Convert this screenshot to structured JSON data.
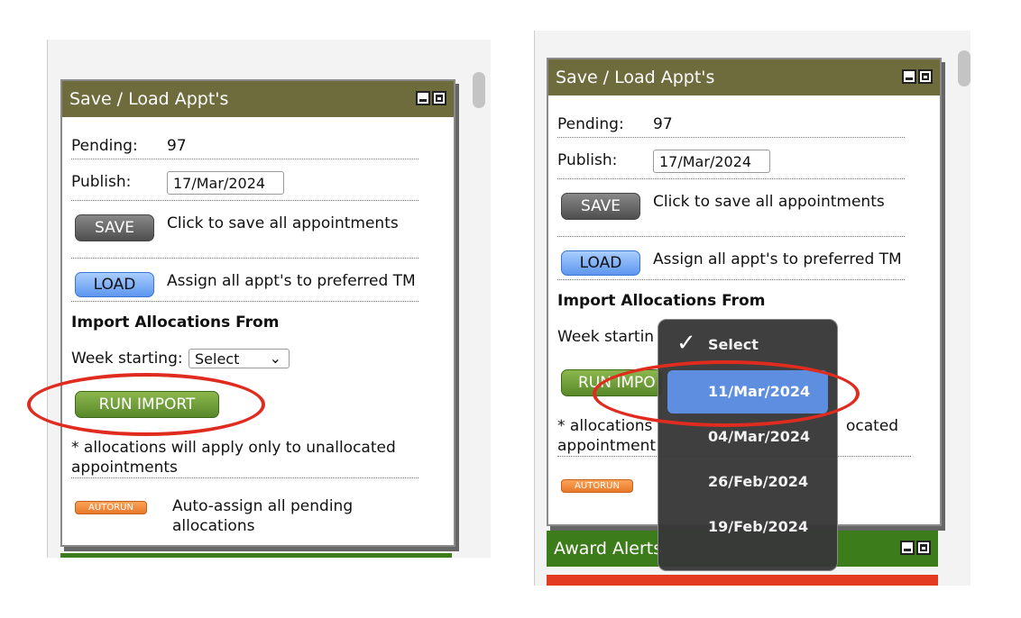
{
  "left": {
    "panel_title": "Save / Load Appt's",
    "pending_label": "Pending:",
    "pending_value": "97",
    "publish_label": "Publish:",
    "publish_date": "17/Mar/2024",
    "save_label": "SAVE",
    "save_desc": "Click to save all appointments",
    "load_label": "LOAD",
    "load_desc": "Assign all appt's to preferred TM",
    "import_heading": "Import Allocations From",
    "week_label": "Week starting:",
    "week_select": "Select",
    "run_label": "RUN IMPORT",
    "note": "* allocations will apply only to unallocated appointments",
    "autorun_label": "AUTORUN",
    "autorun_desc": "Auto-assign all pending allocations"
  },
  "right": {
    "panel_title": "Save / Load Appt's",
    "pending_label": "Pending:",
    "pending_value": "97",
    "publish_label": "Publish:",
    "publish_date": "17/Mar/2024",
    "save_label": "SAVE",
    "save_desc": "Click to save all appointments",
    "load_label": "LOAD",
    "load_desc": "Assign all appt's to preferred TM",
    "import_heading": "Import Allocations From",
    "week_label": "Week startin",
    "run_label": "RUN IMPO",
    "note_a": "* allocations",
    "note_b": "ocated",
    "note_c": "appointment",
    "autorun_label": "AUTORUN",
    "award_title": "Award Alerts",
    "dropdown": {
      "options": [
        "Select",
        "11/Mar/2024",
        "04/Mar/2024",
        "26/Feb/2024",
        "19/Feb/2024"
      ],
      "checked": "Select",
      "highlighted": "11/Mar/2024"
    }
  },
  "colors": {
    "panel_header": "#6e6b3d",
    "highlight_ellipse": "#e02b1f",
    "dropdown_highlight": "#5e8ee0"
  }
}
